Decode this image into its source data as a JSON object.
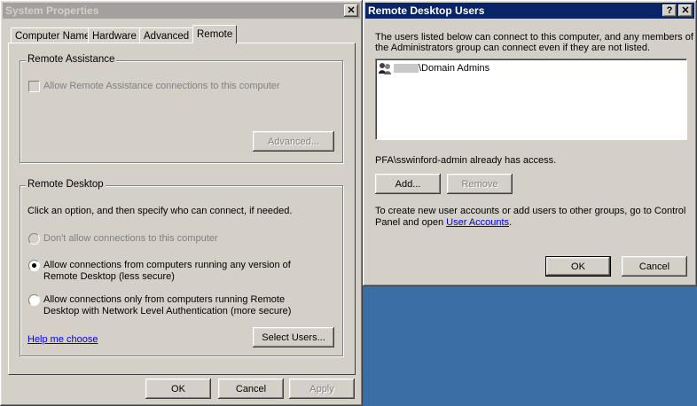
{
  "system_properties": {
    "title": "System Properties",
    "close_glyph": "✕",
    "tabs": [
      "Computer Name",
      "Hardware",
      "Advanced",
      "Remote"
    ],
    "selected_tab": "Remote",
    "remote_assistance": {
      "group_label": "Remote Assistance",
      "checkbox_label": "Allow Remote Assistance connections to this computer",
      "advanced_button": "Advanced..."
    },
    "remote_desktop": {
      "group_label": "Remote Desktop",
      "instruction": "Click an option, and then specify who can connect, if needed.",
      "option_dont_allow": "Don't allow connections to this computer",
      "option_any_line1": "Allow connections from computers running any version of",
      "option_any_line2": "Remote Desktop (less secure)",
      "option_nla_line1": "Allow connections only from computers running Remote",
      "option_nla_line2": "Desktop with Network Level Authentication (more secure)",
      "help_link": "Help me choose",
      "select_users_button": "Select Users..."
    },
    "buttons": {
      "ok": "OK",
      "cancel": "Cancel",
      "apply": "Apply"
    }
  },
  "remote_desktop_users": {
    "title": "Remote Desktop Users",
    "help_glyph": "?",
    "close_glyph": "✕",
    "description_line1": "The users listed below can connect to this computer, and any members of",
    "description_line2": "the Administrators group can connect even if they are not listed.",
    "users": [
      "\\Domain Admins"
    ],
    "access_text": "PFA\\sswinford-admin already has access.",
    "add_button": "Add...",
    "remove_button": "Remove",
    "info_line1": "To create new user accounts or add users to other groups, go to Control",
    "info_line2_prefix": "Panel and open ",
    "info_link": "User Accounts",
    "info_line2_suffix": ".",
    "buttons": {
      "ok": "OK",
      "cancel": "Cancel"
    }
  }
}
